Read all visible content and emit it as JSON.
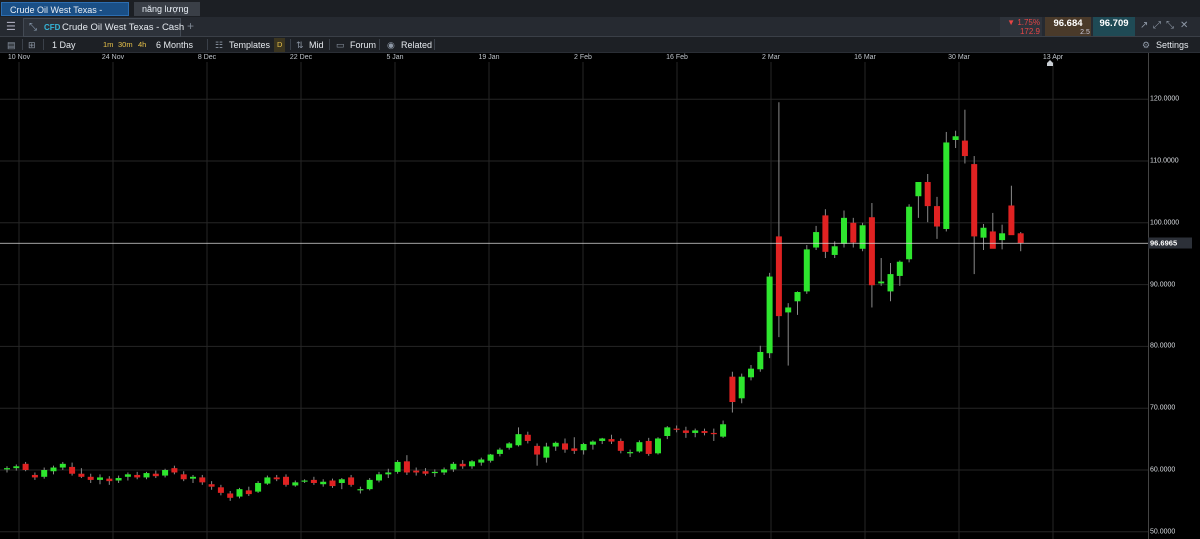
{
  "window_tabs": [
    "Crude Oil West Texas - Cash",
    "năng lượng"
  ],
  "header": {
    "menu_icon": "hamburger-icon",
    "tab_icon": "chart-icon",
    "badge": "CFD",
    "title": "Crude Oil West Texas - Cash",
    "search_icon": "search-icon",
    "add_icon": "plus-icon",
    "change_pct": "▼ 1.75%",
    "change_pts": "172.9",
    "bid": "96.684",
    "spread": "2.5",
    "ask": "96.709",
    "colors": {
      "down": "#e64545",
      "bid_bg": "#4a3a2a",
      "ask_bg": "#1f4a55"
    }
  },
  "toolbar": {
    "interval": "1 Day",
    "quick_intervals": [
      "1m",
      "30m",
      "4h"
    ],
    "range": "6 Months",
    "templates": "Templates",
    "d_badge": "D",
    "mid": "Mid",
    "forum": "Forum",
    "related": "Related",
    "settings": "Settings"
  },
  "chart_data": {
    "type": "candlestick",
    "date_labels": [
      "10 Nov",
      "24 Nov",
      "8 Dec",
      "22 Dec",
      "5 Jan",
      "19 Jan",
      "2 Feb",
      "16 Feb",
      "2 Mar",
      "16 Mar",
      "30 Mar",
      "13 Apr"
    ],
    "y_ticks": [
      "50.0000",
      "60.0000",
      "70.0000",
      "80.0000",
      "90.0000",
      "100.0000",
      "110.0000",
      "120.0000"
    ],
    "y_range": [
      49.5,
      125.5
    ],
    "last_price": 96.6965,
    "last_price_label": "96.6965",
    "colors": {
      "up": "#2ee62e",
      "down": "#e02222",
      "grid": "#262626",
      "line": "#d9d9d9"
    },
    "candles": [
      [
        60.1,
        60.6,
        59.6,
        60.3
      ],
      [
        60.3,
        60.9,
        59.9,
        60.6
      ],
      [
        61.0,
        61.3,
        59.8,
        60.0
      ],
      [
        59.2,
        59.6,
        58.4,
        58.8
      ],
      [
        58.9,
        60.4,
        58.6,
        60.0
      ],
      [
        59.8,
        60.7,
        59.3,
        60.4
      ],
      [
        60.4,
        61.3,
        60.0,
        61.0
      ],
      [
        60.5,
        61.2,
        59.1,
        59.4
      ],
      [
        59.4,
        60.3,
        58.7,
        58.9
      ],
      [
        58.9,
        59.4,
        57.9,
        58.4
      ],
      [
        58.4,
        59.3,
        57.7,
        58.8
      ],
      [
        58.6,
        59.0,
        57.6,
        58.2
      ],
      [
        58.3,
        59.1,
        57.9,
        58.7
      ],
      [
        58.9,
        59.6,
        58.3,
        59.3
      ],
      [
        59.2,
        59.7,
        58.5,
        58.8
      ],
      [
        58.8,
        59.7,
        58.5,
        59.5
      ],
      [
        59.4,
        59.9,
        58.7,
        59.0
      ],
      [
        59.1,
        60.2,
        58.8,
        60.0
      ],
      [
        60.3,
        60.7,
        59.3,
        59.6
      ],
      [
        59.3,
        59.8,
        58.2,
        58.5
      ],
      [
        58.6,
        59.2,
        57.9,
        58.9
      ],
      [
        58.8,
        59.2,
        57.6,
        58.0
      ],
      [
        57.7,
        58.2,
        56.8,
        57.3
      ],
      [
        57.2,
        57.6,
        55.9,
        56.3
      ],
      [
        56.2,
        56.6,
        55.0,
        55.5
      ],
      [
        55.7,
        57.1,
        55.4,
        56.9
      ],
      [
        56.7,
        57.3,
        55.8,
        56.1
      ],
      [
        56.5,
        58.2,
        56.3,
        57.9
      ],
      [
        57.8,
        59.1,
        57.6,
        58.8
      ],
      [
        58.8,
        59.2,
        58.2,
        58.5
      ],
      [
        58.9,
        59.3,
        57.3,
        57.6
      ],
      [
        57.5,
        58.3,
        57.3,
        58.0
      ],
      [
        58.2,
        58.5,
        57.9,
        58.3
      ],
      [
        58.4,
        58.9,
        57.6,
        57.9
      ],
      [
        57.7,
        58.5,
        57.3,
        58.1
      ],
      [
        58.3,
        58.6,
        57.1,
        57.4
      ],
      [
        57.9,
        58.7,
        56.9,
        58.5
      ],
      [
        58.8,
        59.2,
        57.3,
        57.6
      ],
      [
        56.8,
        57.3,
        56.2,
        56.9
      ],
      [
        56.9,
        58.7,
        56.7,
        58.4
      ],
      [
        58.3,
        59.7,
        58.0,
        59.3
      ],
      [
        59.3,
        60.2,
        58.7,
        59.6
      ],
      [
        59.7,
        61.6,
        59.4,
        61.3
      ],
      [
        61.4,
        62.4,
        59.2,
        59.6
      ],
      [
        59.9,
        60.4,
        59.1,
        59.6
      ],
      [
        59.8,
        60.3,
        59.1,
        59.4
      ],
      [
        59.5,
        60.1,
        58.9,
        59.7
      ],
      [
        59.6,
        60.4,
        59.2,
        60.1
      ],
      [
        60.1,
        61.3,
        59.7,
        61.0
      ],
      [
        61.0,
        61.6,
        60.2,
        60.6
      ],
      [
        60.6,
        61.6,
        60.2,
        61.4
      ],
      [
        61.2,
        62.0,
        60.7,
        61.7
      ],
      [
        61.5,
        62.6,
        61.2,
        62.5
      ],
      [
        62.6,
        63.6,
        62.2,
        63.3
      ],
      [
        63.6,
        64.5,
        63.3,
        64.3
      ],
      [
        64.0,
        66.9,
        63.8,
        65.8
      ],
      [
        65.7,
        66.2,
        64.3,
        64.7
      ],
      [
        63.9,
        64.3,
        60.7,
        62.5
      ],
      [
        62.0,
        64.4,
        61.2,
        63.8
      ],
      [
        63.8,
        64.6,
        63.1,
        64.4
      ],
      [
        64.3,
        65.1,
        62.8,
        63.3
      ],
      [
        63.5,
        65.3,
        62.6,
        63.1
      ],
      [
        63.2,
        64.4,
        62.5,
        64.2
      ],
      [
        64.1,
        64.8,
        63.3,
        64.6
      ],
      [
        64.7,
        65.2,
        64.2,
        65.1
      ],
      [
        65.0,
        65.7,
        64.2,
        64.6
      ],
      [
        64.7,
        65.1,
        62.7,
        63.1
      ],
      [
        62.7,
        63.3,
        62.1,
        62.9
      ],
      [
        63.0,
        64.8,
        62.8,
        64.5
      ],
      [
        64.7,
        65.2,
        62.3,
        62.6
      ],
      [
        62.7,
        65.3,
        62.5,
        65.1
      ],
      [
        65.5,
        67.1,
        65.0,
        66.9
      ],
      [
        66.7,
        67.2,
        66.1,
        66.5
      ],
      [
        66.4,
        67.0,
        65.2,
        66.0
      ],
      [
        66.0,
        66.7,
        65.3,
        66.4
      ],
      [
        66.3,
        66.7,
        65.6,
        66.0
      ],
      [
        66.0,
        66.7,
        64.7,
        65.8
      ],
      [
        65.4,
        68.0,
        65.2,
        67.4
      ],
      [
        75.1,
        75.9,
        69.3,
        71.0
      ],
      [
        71.6,
        75.6,
        70.8,
        75.1
      ],
      [
        75.0,
        77.0,
        74.5,
        76.4
      ],
      [
        76.3,
        80.1,
        75.9,
        79.1
      ],
      [
        78.9,
        91.9,
        78.1,
        91.3
      ],
      [
        97.8,
        119.5,
        81.5,
        84.9
      ],
      [
        85.5,
        87.0,
        76.9,
        86.3
      ],
      [
        87.3,
        88.9,
        85.1,
        88.8
      ],
      [
        88.9,
        96.4,
        88.5,
        95.7
      ],
      [
        96.0,
        99.5,
        95.6,
        98.5
      ],
      [
        101.2,
        102.2,
        94.3,
        95.3
      ],
      [
        94.8,
        97.0,
        94.3,
        96.2
      ],
      [
        96.6,
        102.0,
        96.0,
        100.8
      ],
      [
        100.0,
        100.8,
        96.0,
        96.8
      ],
      [
        95.8,
        100.0,
        95.4,
        99.6
      ],
      [
        100.9,
        103.2,
        86.3,
        89.9
      ],
      [
        90.2,
        94.3,
        89.8,
        90.5
      ],
      [
        88.9,
        93.5,
        87.3,
        91.7
      ],
      [
        91.4,
        93.9,
        89.8,
        93.7
      ],
      [
        94.1,
        103.0,
        93.6,
        102.6
      ],
      [
        104.3,
        106.6,
        100.8,
        106.6
      ],
      [
        106.6,
        107.9,
        100.1,
        102.7
      ],
      [
        102.7,
        104.2,
        97.4,
        99.4
      ],
      [
        99.0,
        114.7,
        98.6,
        113.0
      ],
      [
        113.4,
        114.9,
        112.1,
        114.0
      ],
      [
        113.3,
        118.3,
        109.6,
        110.8
      ],
      [
        109.5,
        110.8,
        91.7,
        97.8
      ],
      [
        97.6,
        99.8,
        95.6,
        99.2
      ],
      [
        98.6,
        101.6,
        96.4,
        95.8
      ],
      [
        97.2,
        99.7,
        95.7,
        98.3
      ],
      [
        102.8,
        106.0,
        98.6,
        98.0
      ],
      [
        98.3,
        98.5,
        95.4,
        96.7
      ]
    ]
  }
}
